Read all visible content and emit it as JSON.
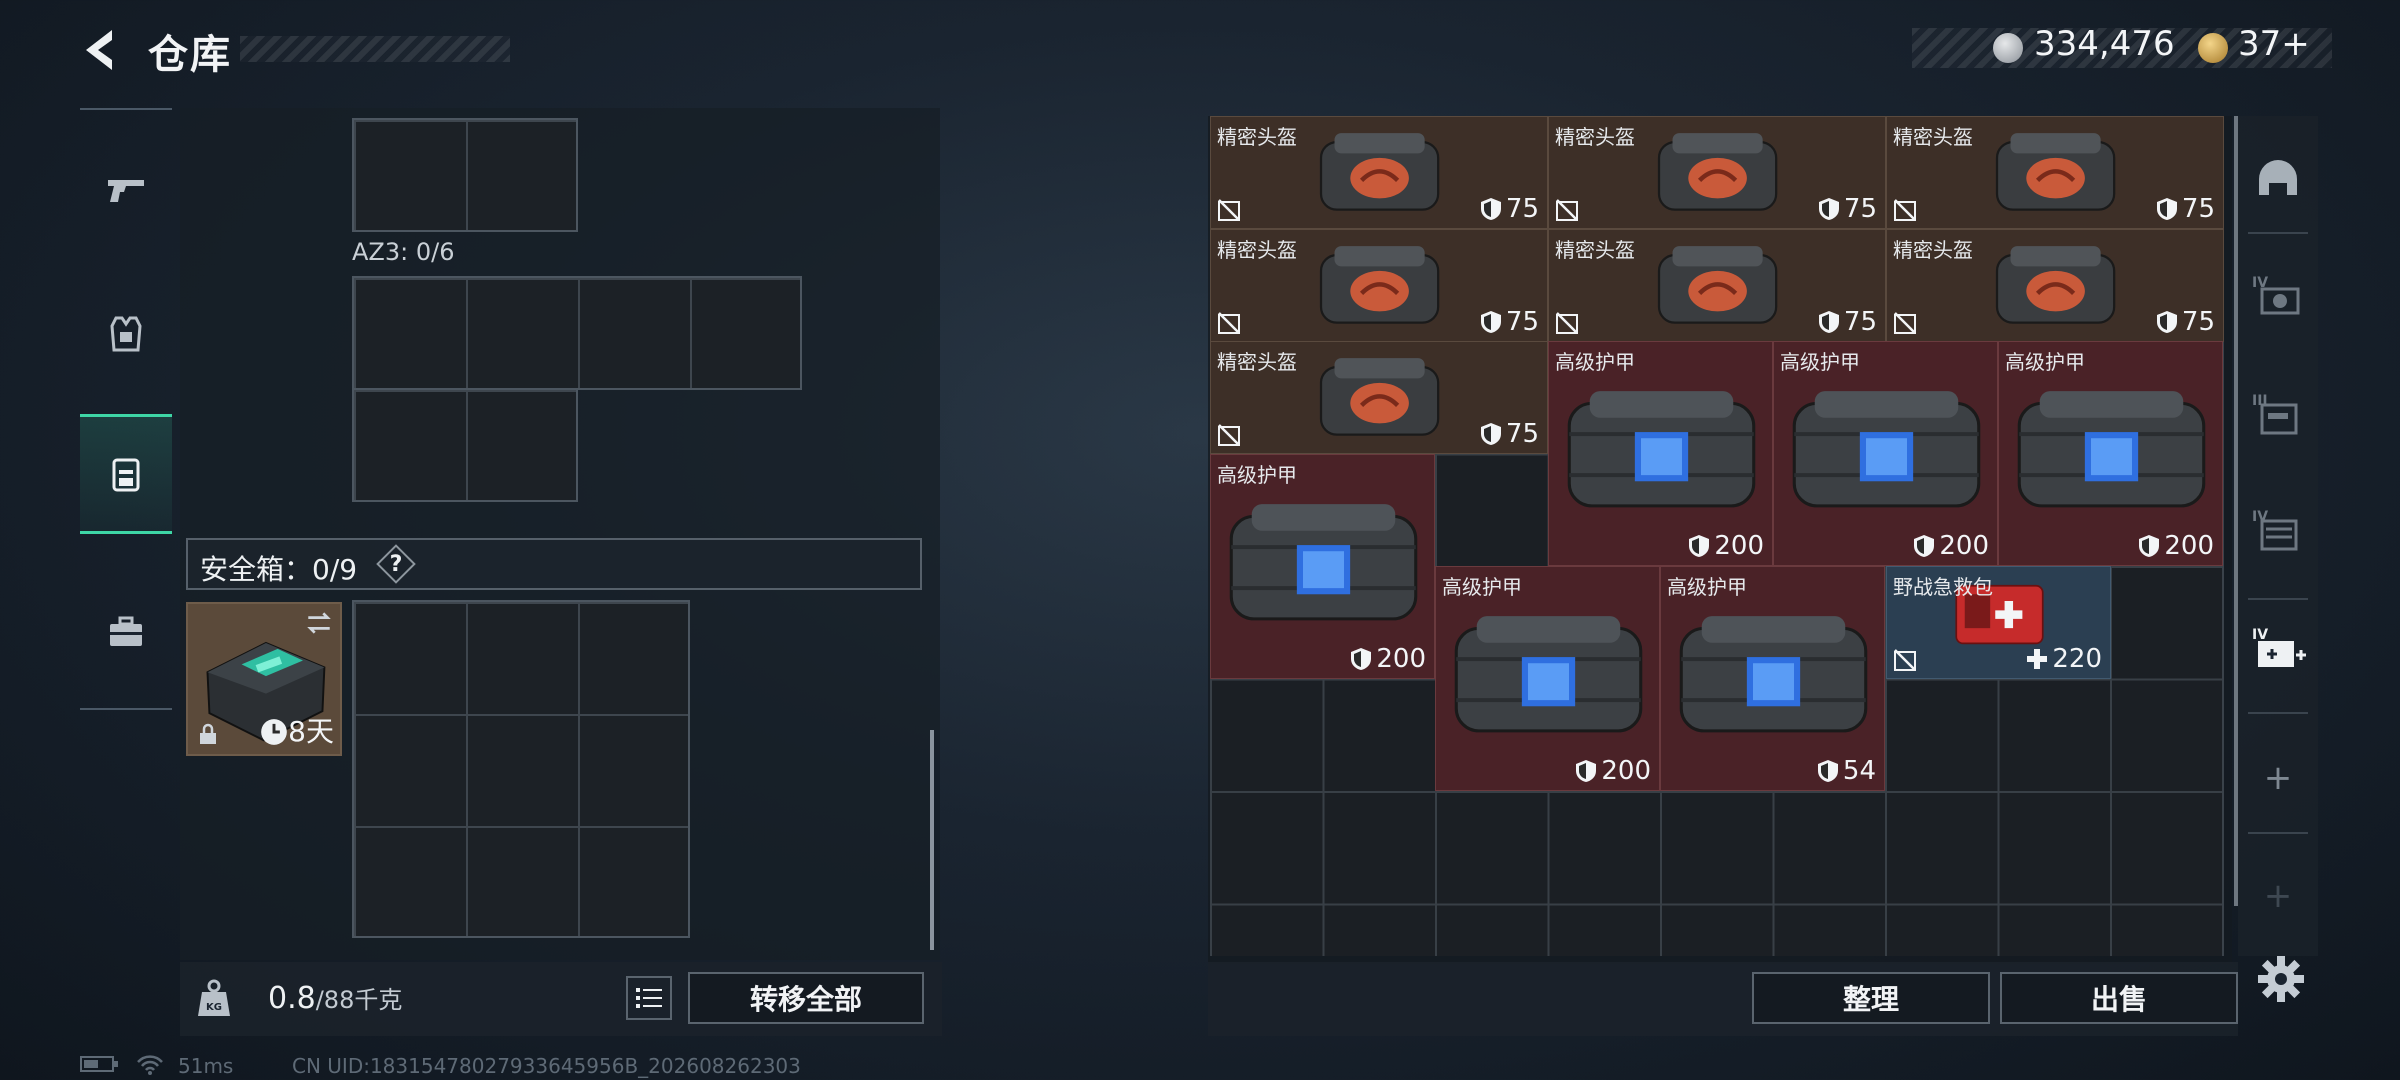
{
  "header": {
    "title": "仓库",
    "currency_silver": "334,476",
    "currency_gold": "37+"
  },
  "left_panel": {
    "az3_label": "AZ3: 0/6",
    "safe_box_label": "安全箱：0/9",
    "safe_box_help": "?",
    "safe_item_timer": "8天",
    "weight_value": "0.8",
    "weight_max": "/88千克",
    "transfer_all": "转移全部"
  },
  "inventory": {
    "items": [
      {
        "name": "精密头盔",
        "value": "75",
        "type": "helmet"
      },
      {
        "name": "精密头盔",
        "value": "75",
        "type": "helmet"
      },
      {
        "name": "精密头盔",
        "value": "75",
        "type": "helmet"
      },
      {
        "name": "精密头盔",
        "value": "75",
        "type": "helmet"
      },
      {
        "name": "精密头盔",
        "value": "75",
        "type": "helmet"
      },
      {
        "name": "精密头盔",
        "value": "75",
        "type": "helmet"
      },
      {
        "name": "精密头盔",
        "value": "75",
        "type": "helmet"
      },
      {
        "name": "高级护甲",
        "value": "200",
        "type": "armor"
      },
      {
        "name": "高级护甲",
        "value": "200",
        "type": "armor"
      },
      {
        "name": "高级护甲",
        "value": "200",
        "type": "armor"
      },
      {
        "name": "高级护甲",
        "value": "200",
        "type": "armor"
      },
      {
        "name": "高级护甲",
        "value": "200",
        "type": "armor"
      },
      {
        "name": "高级护甲",
        "value": "54",
        "type": "armor"
      },
      {
        "name": "野战急救包",
        "value": "220",
        "type": "medkit"
      }
    ],
    "sort_button": "整理",
    "sell_button": "出售"
  },
  "rail": {
    "tier_iv_a": "IV",
    "tier_iii": "III",
    "tier_iv_b": "IV",
    "tier_iv_c": "IV",
    "add_1": "+",
    "add_2": "+"
  },
  "status": {
    "ping": "51ms",
    "uid": "CN UID:18315478027933645956B_202608262303"
  },
  "colors": {
    "accent_green": "#3ed6a6",
    "helmet_bg": "#3d2f27",
    "armor_bg": "#4a2227",
    "medkit_bg": "#2b3f52"
  }
}
